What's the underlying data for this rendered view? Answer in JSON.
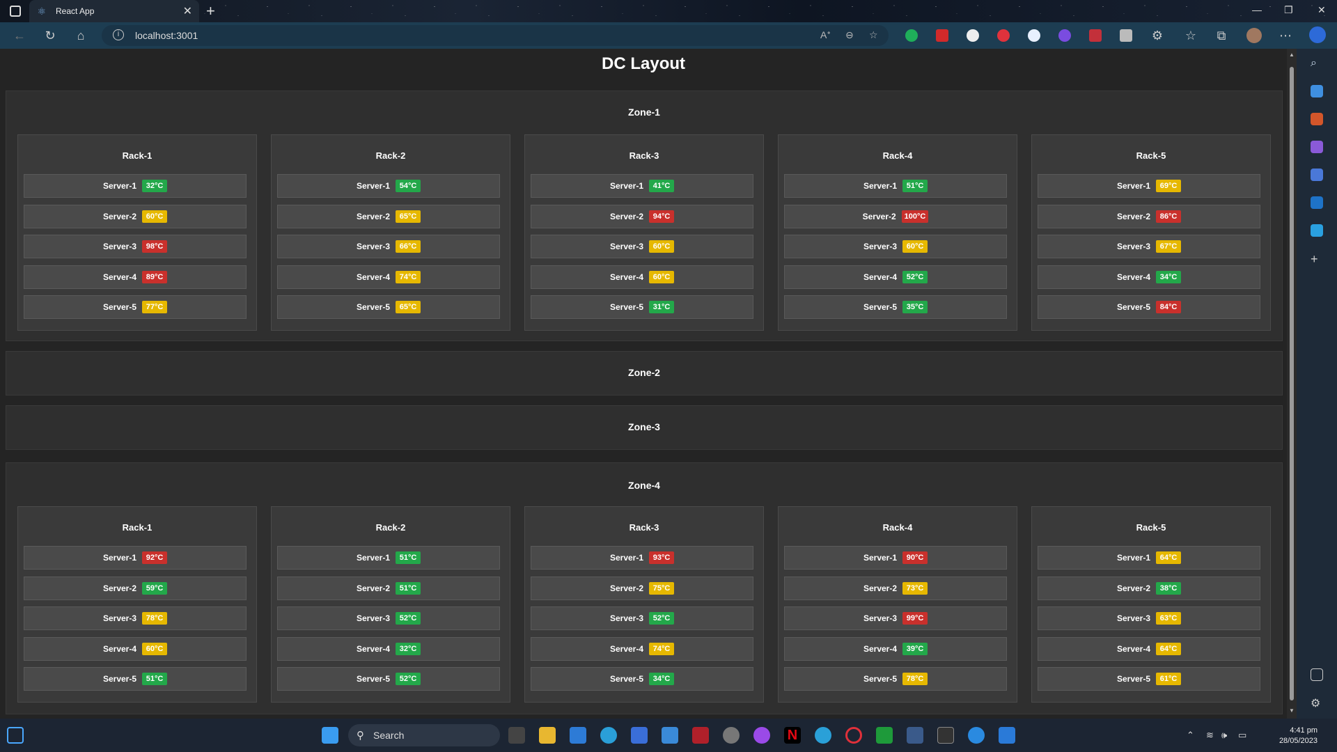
{
  "browser": {
    "tab_title": "React App",
    "url": "localhost:3001"
  },
  "page": {
    "title": "DC Layout"
  },
  "zones": [
    {
      "name": "Zone-1",
      "racks": [
        {
          "name": "Rack-1",
          "servers": [
            {
              "name": "Server-1",
              "temp": "32°C",
              "level": "green"
            },
            {
              "name": "Server-2",
              "temp": "60°C",
              "level": "yellow"
            },
            {
              "name": "Server-3",
              "temp": "98°C",
              "level": "red"
            },
            {
              "name": "Server-4",
              "temp": "89°C",
              "level": "red"
            },
            {
              "name": "Server-5",
              "temp": "77°C",
              "level": "yellow"
            }
          ]
        },
        {
          "name": "Rack-2",
          "servers": [
            {
              "name": "Server-1",
              "temp": "54°C",
              "level": "green"
            },
            {
              "name": "Server-2",
              "temp": "65°C",
              "level": "yellow"
            },
            {
              "name": "Server-3",
              "temp": "66°C",
              "level": "yellow"
            },
            {
              "name": "Server-4",
              "temp": "74°C",
              "level": "yellow"
            },
            {
              "name": "Server-5",
              "temp": "65°C",
              "level": "yellow"
            }
          ]
        },
        {
          "name": "Rack-3",
          "servers": [
            {
              "name": "Server-1",
              "temp": "41°C",
              "level": "green"
            },
            {
              "name": "Server-2",
              "temp": "94°C",
              "level": "red"
            },
            {
              "name": "Server-3",
              "temp": "60°C",
              "level": "yellow"
            },
            {
              "name": "Server-4",
              "temp": "60°C",
              "level": "yellow"
            },
            {
              "name": "Server-5",
              "temp": "31°C",
              "level": "green"
            }
          ]
        },
        {
          "name": "Rack-4",
          "servers": [
            {
              "name": "Server-1",
              "temp": "51°C",
              "level": "green"
            },
            {
              "name": "Server-2",
              "temp": "100°C",
              "level": "red"
            },
            {
              "name": "Server-3",
              "temp": "60°C",
              "level": "yellow"
            },
            {
              "name": "Server-4",
              "temp": "52°C",
              "level": "green"
            },
            {
              "name": "Server-5",
              "temp": "35°C",
              "level": "green"
            }
          ]
        },
        {
          "name": "Rack-5",
          "servers": [
            {
              "name": "Server-1",
              "temp": "69°C",
              "level": "yellow"
            },
            {
              "name": "Server-2",
              "temp": "86°C",
              "level": "red"
            },
            {
              "name": "Server-3",
              "temp": "67°C",
              "level": "yellow"
            },
            {
              "name": "Server-4",
              "temp": "34°C",
              "level": "green"
            },
            {
              "name": "Server-5",
              "temp": "84°C",
              "level": "red"
            }
          ]
        }
      ]
    },
    {
      "name": "Zone-2",
      "racks": []
    },
    {
      "name": "Zone-3",
      "racks": []
    },
    {
      "name": "Zone-4",
      "racks": [
        {
          "name": "Rack-1",
          "servers": [
            {
              "name": "Server-1",
              "temp": "92°C",
              "level": "red"
            },
            {
              "name": "Server-2",
              "temp": "59°C",
              "level": "green"
            },
            {
              "name": "Server-3",
              "temp": "78°C",
              "level": "yellow"
            },
            {
              "name": "Server-4",
              "temp": "60°C",
              "level": "yellow"
            },
            {
              "name": "Server-5",
              "temp": "51°C",
              "level": "green"
            }
          ]
        },
        {
          "name": "Rack-2",
          "servers": [
            {
              "name": "Server-1",
              "temp": "51°C",
              "level": "green"
            },
            {
              "name": "Server-2",
              "temp": "51°C",
              "level": "green"
            },
            {
              "name": "Server-3",
              "temp": "52°C",
              "level": "green"
            },
            {
              "name": "Server-4",
              "temp": "32°C",
              "level": "green"
            },
            {
              "name": "Server-5",
              "temp": "52°C",
              "level": "green"
            }
          ]
        },
        {
          "name": "Rack-3",
          "servers": [
            {
              "name": "Server-1",
              "temp": "93°C",
              "level": "red"
            },
            {
              "name": "Server-2",
              "temp": "75°C",
              "level": "yellow"
            },
            {
              "name": "Server-3",
              "temp": "52°C",
              "level": "green"
            },
            {
              "name": "Server-4",
              "temp": "74°C",
              "level": "yellow"
            },
            {
              "name": "Server-5",
              "temp": "34°C",
              "level": "green"
            }
          ]
        },
        {
          "name": "Rack-4",
          "servers": [
            {
              "name": "Server-1",
              "temp": "90°C",
              "level": "red"
            },
            {
              "name": "Server-2",
              "temp": "73°C",
              "level": "yellow"
            },
            {
              "name": "Server-3",
              "temp": "99°C",
              "level": "red"
            },
            {
              "name": "Server-4",
              "temp": "39°C",
              "level": "green"
            },
            {
              "name": "Server-5",
              "temp": "78°C",
              "level": "yellow"
            }
          ]
        },
        {
          "name": "Rack-5",
          "servers": [
            {
              "name": "Server-1",
              "temp": "64°C",
              "level": "yellow"
            },
            {
              "name": "Server-2",
              "temp": "38°C",
              "level": "green"
            },
            {
              "name": "Server-3",
              "temp": "63°C",
              "level": "yellow"
            },
            {
              "name": "Server-4",
              "temp": "64°C",
              "level": "yellow"
            },
            {
              "name": "Server-5",
              "temp": "61°C",
              "level": "yellow"
            }
          ]
        }
      ]
    }
  ],
  "status_colors": {
    "green": "#23a84a",
    "yellow": "#e6b800",
    "red": "#c9302c"
  },
  "taskbar": {
    "search_label": "Search",
    "time": "4:41 pm",
    "date": "28/05/2023"
  }
}
